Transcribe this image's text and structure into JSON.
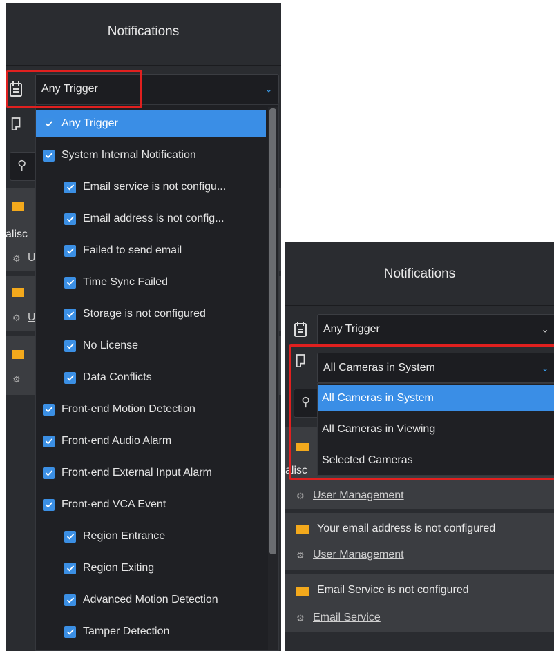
{
  "left": {
    "title": "Notifications",
    "trigger_select": "Any Trigger",
    "trigger_options": [
      {
        "label": "Any Trigger",
        "level": 0,
        "checked": true,
        "selected": true
      },
      {
        "label": "System Internal Notification",
        "level": 0,
        "checked": true
      },
      {
        "label": "Email service is not configu...",
        "level": 1,
        "checked": true
      },
      {
        "label": "Email address is not config...",
        "level": 1,
        "checked": true
      },
      {
        "label": "Failed to send email",
        "level": 1,
        "checked": true
      },
      {
        "label": "Time Sync Failed",
        "level": 1,
        "checked": true
      },
      {
        "label": "Storage is not configured",
        "level": 1,
        "checked": true
      },
      {
        "label": "No License",
        "level": 1,
        "checked": true
      },
      {
        "label": "Data Conflicts",
        "level": 1,
        "checked": true
      },
      {
        "label": "Front-end Motion Detection",
        "level": 0,
        "checked": true
      },
      {
        "label": "Front-end Audio Alarm",
        "level": 0,
        "checked": true
      },
      {
        "label": "Front-end External Input Alarm",
        "level": 0,
        "checked": true
      },
      {
        "label": "Front-end VCA Event",
        "level": 0,
        "checked": true
      },
      {
        "label": "Region Entrance",
        "level": 1,
        "checked": true
      },
      {
        "label": "Region Exiting",
        "level": 1,
        "checked": true
      },
      {
        "label": "Advanced Motion Detection",
        "level": 1,
        "checked": true
      },
      {
        "label": "Tamper Detection",
        "level": 1,
        "checked": true
      }
    ],
    "partial_user": "alisc",
    "partial_link": "U"
  },
  "right": {
    "title": "Notifications",
    "trigger_select": "Any Trigger",
    "camera_select": "All Cameras in System",
    "camera_options": [
      {
        "label": "All Cameras in System",
        "selected": true
      },
      {
        "label": "All Cameras in Viewing"
      },
      {
        "label": "Selected Cameras"
      }
    ],
    "partial_user": "alisc",
    "notifications": [
      {
        "text": "",
        "link": "User Management",
        "icon": "envelope-icon"
      },
      {
        "text": "Your email address is not configured",
        "link": "User Management",
        "icon": "envelope-icon"
      },
      {
        "text": "Email Service is not configured",
        "link": "Email Service",
        "icon": "envelope-arrow-icon"
      }
    ]
  },
  "colors": {
    "panel_bg": "#2a2c30",
    "accent": "#3a8ee6",
    "highlight_box": "#e0201f",
    "envelope": "#f3a91c"
  }
}
